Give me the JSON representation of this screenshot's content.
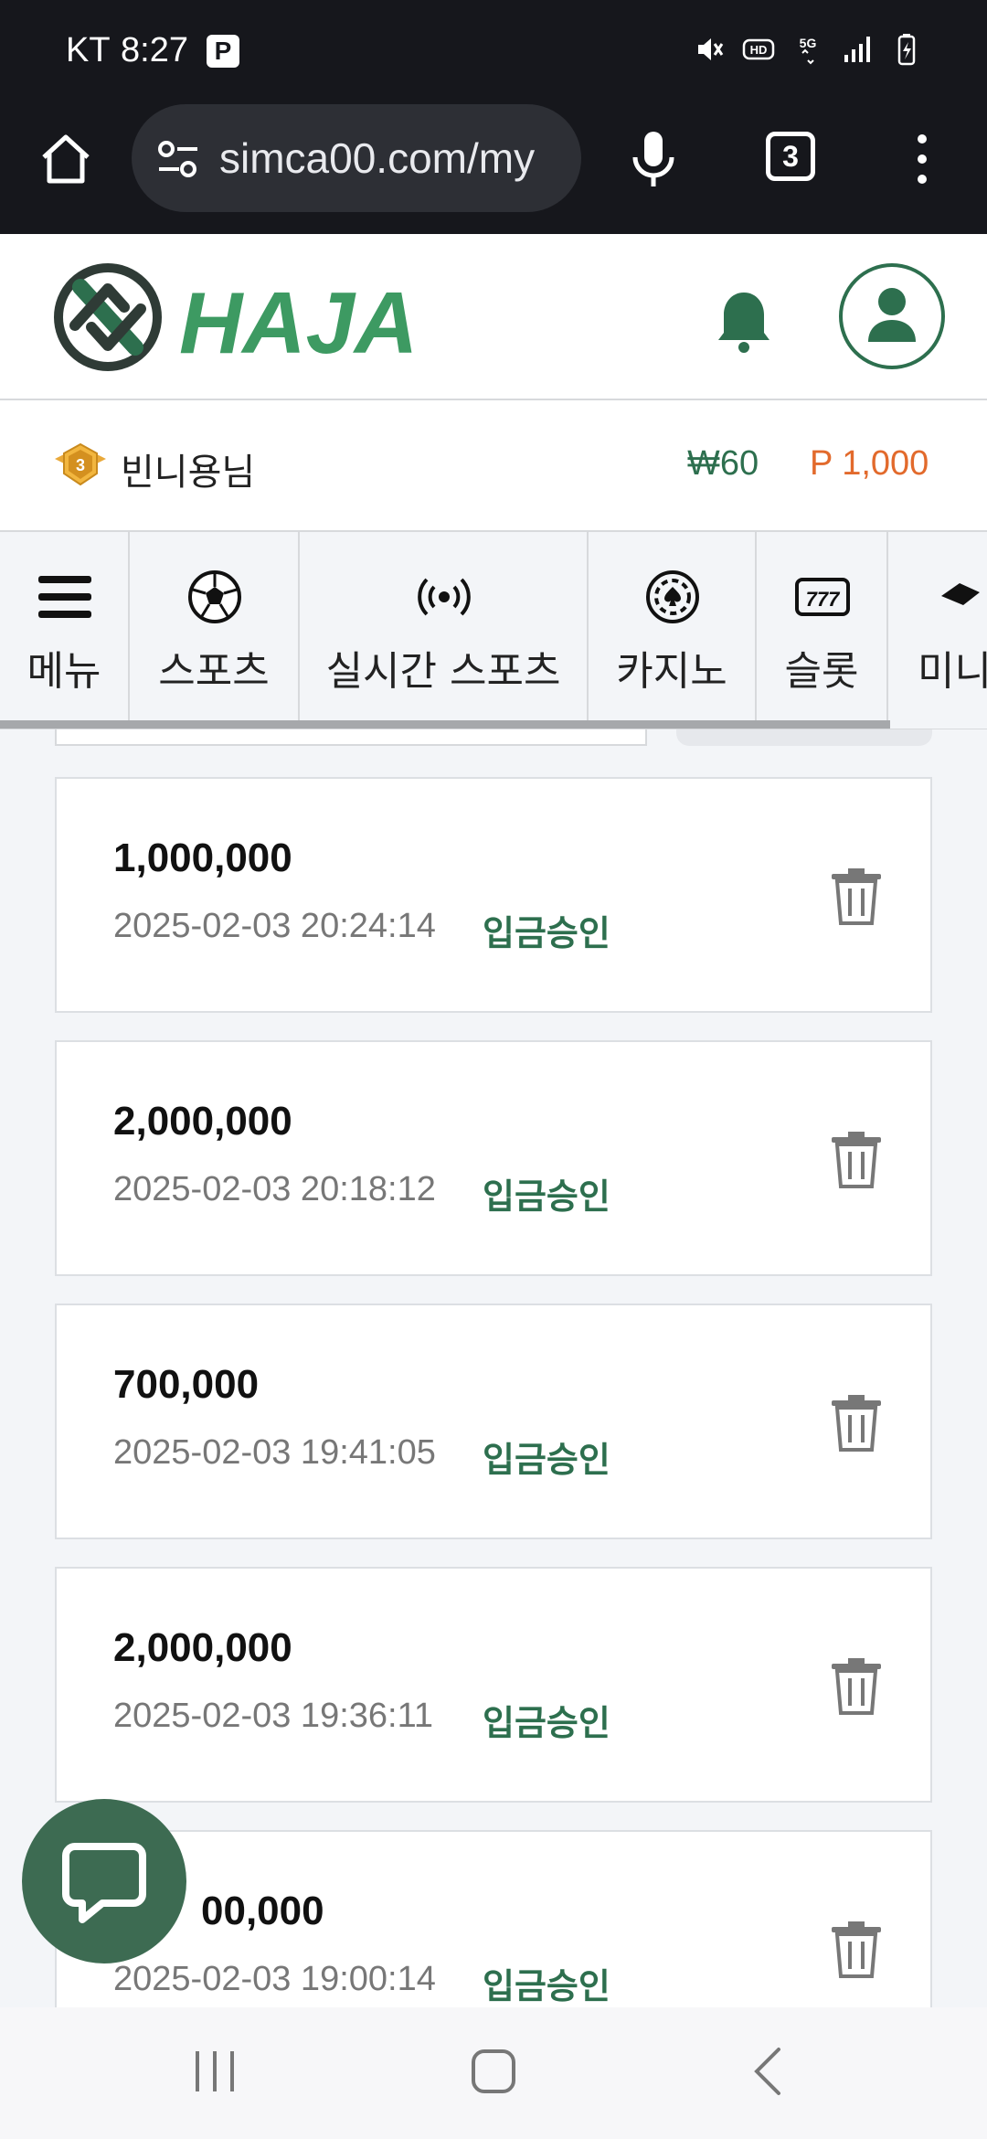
{
  "status_bar": {
    "carrier": "KT",
    "time": "8:27",
    "notification_badge": "P",
    "icons": [
      "mute-icon",
      "hd-icon",
      "5g-icon",
      "signal-icon",
      "battery-charging-icon"
    ]
  },
  "browser": {
    "url": "simca00.com/my",
    "tab_count": "3",
    "icons": [
      "home-icon",
      "site-settings-icon",
      "mic-icon",
      "more-icon"
    ]
  },
  "site": {
    "logo_text": "HAJA",
    "brand_color": "#2d6f4e",
    "icons": [
      "bell-icon",
      "user-icon"
    ]
  },
  "user": {
    "level": "3",
    "name": "빈니용님",
    "balance": "₩60",
    "points": "P 1,000"
  },
  "nav": {
    "items": [
      {
        "label": "메뉴",
        "icon": "menu-icon"
      },
      {
        "label": "스포츠",
        "icon": "soccer-ball-icon"
      },
      {
        "label": "실시간 스포츠",
        "icon": "live-broadcast-icon"
      },
      {
        "label": "카지노",
        "icon": "casino-chip-icon"
      },
      {
        "label": "슬롯",
        "icon": "slot-777-icon"
      },
      {
        "label": "미니",
        "icon": "mini-game-icon"
      }
    ]
  },
  "deposits": [
    {
      "amount": "1,000,000",
      "datetime": "2025-02-03 20:24:14",
      "status": "입금승인"
    },
    {
      "amount": "2,000,000",
      "datetime": "2025-02-03 20:18:12",
      "status": "입금승인"
    },
    {
      "amount": "700,000",
      "datetime": "2025-02-03 19:41:05",
      "status": "입금승인"
    },
    {
      "amount": "2,000,000",
      "datetime": "2025-02-03 19:36:11",
      "status": "입금승인"
    },
    {
      "amount": "00,000",
      "datetime": "2025-02-03 19:00:14",
      "status": "입금승인"
    }
  ],
  "chat": {
    "icon": "chat-bubble-icon"
  }
}
